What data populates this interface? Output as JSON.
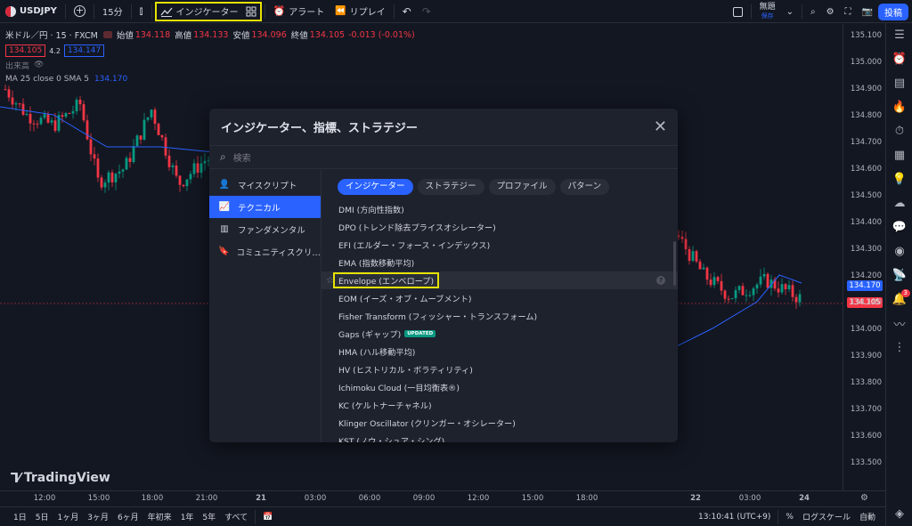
{
  "toolbar": {
    "symbol": "USDJPY",
    "add_icon": "plus-circle-icon",
    "interval": "15分",
    "indicators_label": "インジケーター",
    "alert_label": "アラート",
    "replay_label": "リプレイ",
    "unnamed_label": "無題",
    "save_label": "保存",
    "post_label": "投稿"
  },
  "legend": {
    "title": "米ドル／円 · 15 · FXCM",
    "open_lbl": "始値",
    "open": "134.118",
    "high_lbl": "高値",
    "high": "134.133",
    "low_lbl": "安値",
    "low": "134.096",
    "close_lbl": "終値",
    "close": "134.105",
    "change": "-0.013 (-0.01%)",
    "sell_price": "134.105",
    "spread": "4.2",
    "buy_price": "134.147",
    "volume_label": "出来高",
    "ma_label": "MA 25 close 0 SMA 5",
    "ma_value": "134.170"
  },
  "price_axis": {
    "ticks": [
      "135.100",
      "135.000",
      "134.900",
      "134.800",
      "134.700",
      "134.600",
      "134.500",
      "134.400",
      "134.300",
      "134.200",
      "134.100",
      "134.000",
      "133.900",
      "133.800",
      "133.700",
      "133.600",
      "133.500"
    ],
    "ma_tag": "134.170",
    "last_tag": "134.105",
    "ma_color": "#2962ff",
    "last_color": "#f23645"
  },
  "time_axis": {
    "ticks": [
      "12:00",
      "15:00",
      "18:00",
      "21:00",
      "21",
      "03:00",
      "06:00",
      "09:00",
      "12:00",
      "15:00",
      "18:00",
      "22",
      "03:00",
      "24"
    ]
  },
  "bottom_bar": {
    "ranges": [
      "1日",
      "5日",
      "1ヶ月",
      "3ヶ月",
      "6ヶ月",
      "年初来",
      "1年",
      "5年",
      "すべて"
    ],
    "time": "13:10:41 (UTC+9)",
    "percent": "%",
    "log_scale": "ログスケール",
    "auto": "自動"
  },
  "brand": "TradingView",
  "modal": {
    "title": "インジケーター、指標、ストラテジー",
    "search_placeholder": "検索",
    "nav": [
      {
        "label": "マイスクリプト",
        "icon": "user-icon"
      },
      {
        "label": "テクニカル",
        "icon": "chart-icon"
      },
      {
        "label": "ファンダメンタル",
        "icon": "bar-chart-icon"
      },
      {
        "label": "コミュニティスクリ…",
        "icon": "bookmark-icon"
      }
    ],
    "chips": [
      "インジケーター",
      "ストラテジー",
      "プロファイル",
      "パターン"
    ],
    "items": [
      "DMI (方向性指数)",
      "DPO (トレンド除去プライスオシレーター)",
      "EFI (エルダー・フォース・インデックス)",
      "EMA (指数移動平均)",
      "Envelope (エンベロープ)",
      "EOM (イーズ・オブ・ムーブメント)",
      "Fisher Transform (フィッシャー・トランスフォーム)",
      "Gaps (ギャップ)",
      "HMA (ハル移動平均)",
      "HV (ヒストリカル・ボラティリティ)",
      "Ichimoku Cloud (一目均衡表®)",
      "KC (ケルトナーチャネル)",
      "Klinger Oscillator (クリンガー・オシレーター)",
      "KST (ノウ・シュア・シング)"
    ],
    "updated_badge": "UPDATED"
  }
}
